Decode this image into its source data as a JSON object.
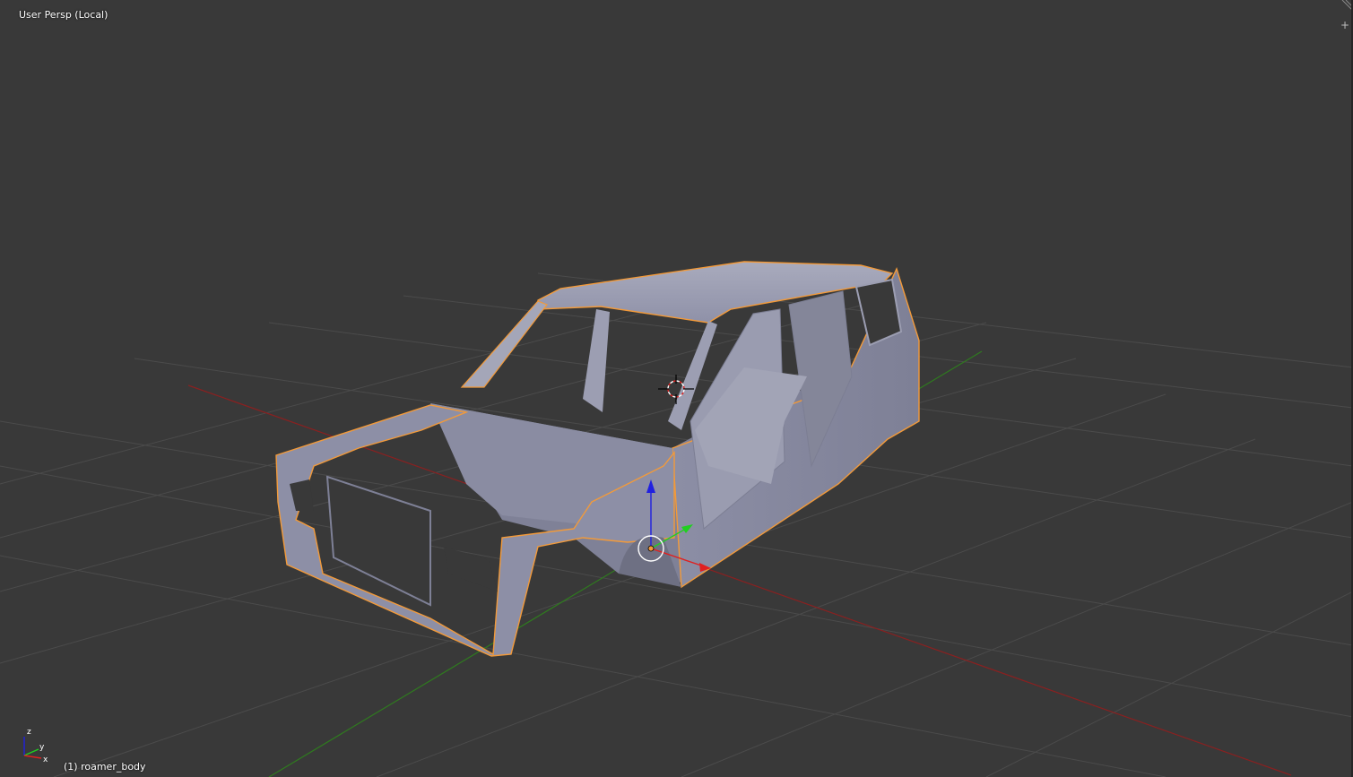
{
  "viewport": {
    "view_label": "User Persp (Local)",
    "object_label": "(1) roamer_body",
    "corner_widget_glyph": "+"
  },
  "mini_axes": {
    "x_label": "x",
    "y_label": "y",
    "z_label": "z"
  },
  "colors": {
    "background": "#393939",
    "grid": "#4b4b4b",
    "x_axis": "#8a2020",
    "y_axis": "#2f7a1f",
    "selection_outline": "#f29a3a",
    "mesh": "#8f91a8",
    "gizmo_x": "#e02020",
    "gizmo_y": "#20d020",
    "gizmo_z": "#2020e0"
  },
  "icons": [
    "3d-cursor-icon",
    "origin-point-icon",
    "transform-gizmo-icon",
    "axis-orientation-icon",
    "add-region-icon"
  ]
}
